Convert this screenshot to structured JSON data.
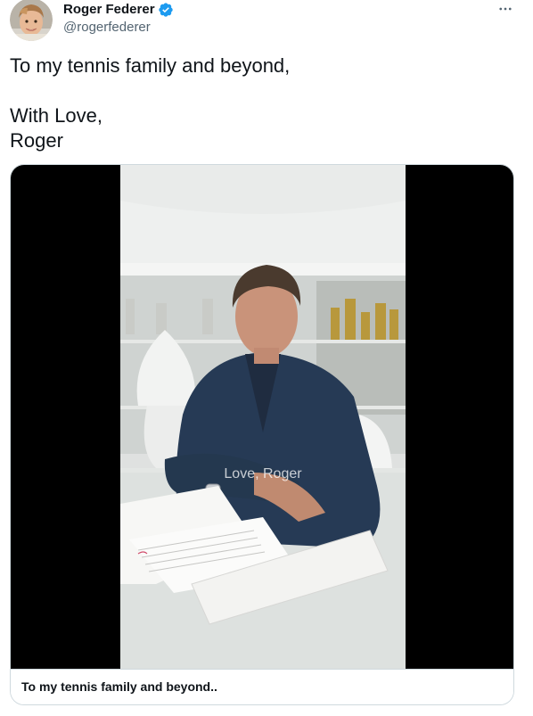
{
  "author": {
    "display_name": "Roger Federer",
    "handle": "@rogerfederer",
    "verified": true
  },
  "tweet": {
    "lines": [
      "To my tennis family and beyond,",
      "",
      "With Love,",
      "Roger"
    ]
  },
  "media": {
    "type": "video",
    "overlay_text": "Love, Roger",
    "caption": "To my tennis family and beyond.."
  },
  "icons": {
    "verified": "verified-badge-icon",
    "more": "more-horizontal-icon"
  },
  "colors": {
    "text": "#0f1419",
    "secondary": "#536471",
    "verified": "#1d9bf0",
    "border": "#cfd9de"
  }
}
